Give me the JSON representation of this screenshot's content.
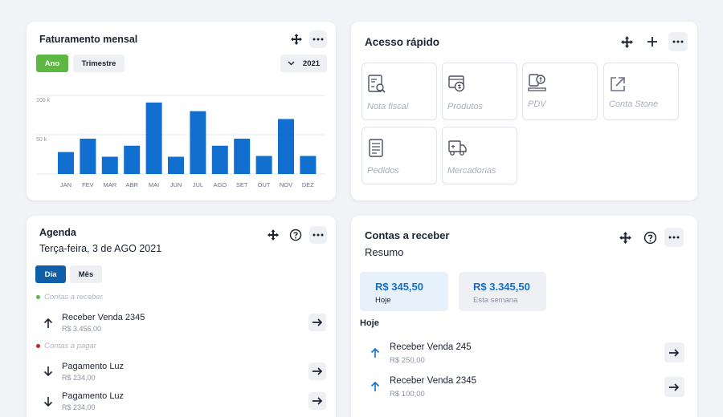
{
  "faturamento": {
    "title": "Faturamento mensal",
    "tab_ano": "Ano",
    "tab_trimestre": "Trimestre",
    "year": "2021",
    "chart_data": {
      "type": "bar",
      "categories": [
        "JAN",
        "FEV",
        "MAR",
        "ABR",
        "MAI",
        "JUN",
        "JUL",
        "AGO",
        "SET",
        "OUT",
        "NOV",
        "DEZ"
      ],
      "values": [
        28,
        45,
        22,
        36,
        91,
        22,
        80,
        36,
        45,
        23,
        70,
        23
      ],
      "ytick_labels": [
        "100 k",
        "50 k"
      ],
      "ylim": [
        0,
        100
      ],
      "grid": true,
      "color": "#1170cf"
    }
  },
  "acesso": {
    "title": "Acesso rápido",
    "tiles": [
      {
        "label": "Nota fiscal",
        "icon": "invoice-search-icon"
      },
      {
        "label": "Produtos",
        "icon": "product-box-icon"
      },
      {
        "label": "PDV",
        "icon": "pos-terminal-icon"
      },
      {
        "label": "Conta Stone",
        "icon": "external-link-icon"
      },
      {
        "label": "Pedidos",
        "icon": "orders-list-icon"
      },
      {
        "label": "Mercadorias",
        "icon": "delivery-truck-icon"
      }
    ]
  },
  "agenda": {
    "title": "Agenda",
    "date": "Terça-feira, 3 de AGO 2021",
    "tab_dia": "Dia",
    "tab_mes": "Mês",
    "receber_label": "Contas a receber",
    "pagar_label": "Contas a pagar",
    "receber_items": [
      {
        "title": "Receber Venda 2345",
        "amount": "R$ 3.456,00"
      }
    ],
    "pagar_items": [
      {
        "title": "Pagamento Luz",
        "amount": "R$ 234,00"
      },
      {
        "title": "Pagamento Luz",
        "amount": "R$ 234,00"
      }
    ]
  },
  "contas": {
    "title": "Contas a receber",
    "subtitle": "Resumo",
    "summary": [
      {
        "value": "R$ 345,50",
        "label": "Hoje"
      },
      {
        "value": "R$ 3.345,50",
        "label": "Esta semana"
      }
    ],
    "section": "Hoje",
    "items": [
      {
        "title": "Receber Venda 245",
        "amount": "R$ 250,00"
      },
      {
        "title": "Receber Venda 2345",
        "amount": "R$ 100,00"
      }
    ]
  },
  "colors": {
    "accent_blue": "#1170cf",
    "dark_blue": "#0e5ea8",
    "green": "#5db742",
    "red": "#d62020"
  }
}
